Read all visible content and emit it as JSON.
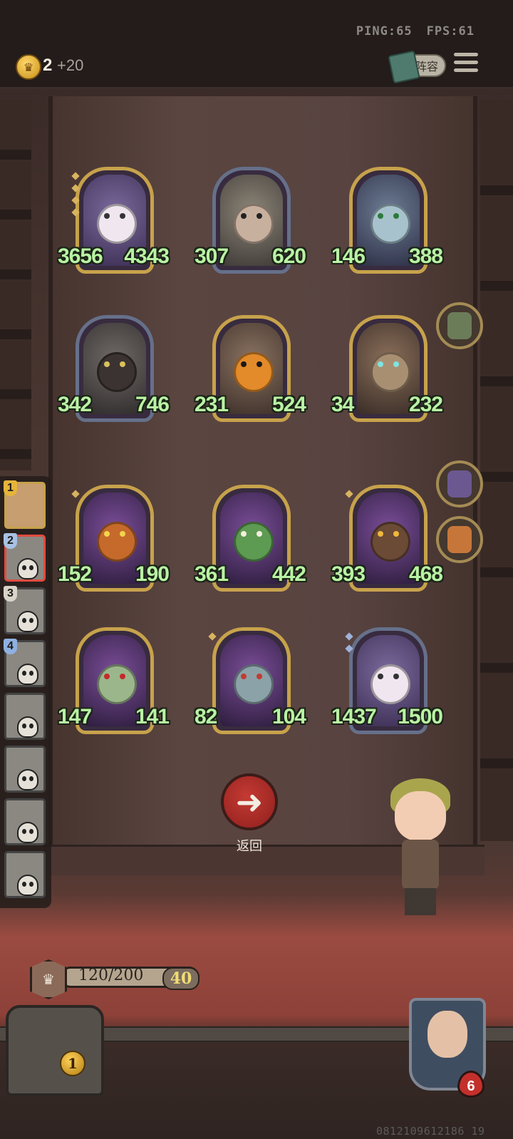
{
  "hud": {
    "ping": "PING:65",
    "fps": "FPS:61",
    "coins": "2",
    "coin_income": "+20",
    "lineup_label": "阵容"
  },
  "cards": [
    {
      "atk": "3656",
      "hp": "4343",
      "frame": "gold",
      "stars": 4,
      "star_color": "gold",
      "name_icon": "hero-witch-icon"
    },
    {
      "atk": "307",
      "hp": "620",
      "frame": "silver",
      "stars": 0,
      "name_icon": "hero-brute-icon"
    },
    {
      "atk": "146",
      "hp": "388",
      "frame": "gold",
      "stars": 0,
      "name_icon": "hero-elf-icon"
    },
    {
      "atk": "342",
      "hp": "746",
      "frame": "silver",
      "stars": 0,
      "name_icon": "hero-dragon-icon"
    },
    {
      "atk": "231",
      "hp": "524",
      "frame": "gold",
      "stars": 0,
      "name_icon": "hero-pumpkin-icon"
    },
    {
      "atk": "34",
      "hp": "232",
      "frame": "gold",
      "stars": 0,
      "name_icon": "hero-treant-icon"
    },
    {
      "atk": "152",
      "hp": "190",
      "frame": "gold",
      "stars": 1,
      "star_color": "gold",
      "name_icon": "hero-pumpkin-beast-icon"
    },
    {
      "atk": "361",
      "hp": "442",
      "frame": "gold",
      "stars": 0,
      "name_icon": "hero-cactus-icon"
    },
    {
      "atk": "393",
      "hp": "468",
      "frame": "gold",
      "stars": 1,
      "star_color": "gold",
      "name_icon": "hero-tiki-icon"
    },
    {
      "atk": "147",
      "hp": "141",
      "frame": "gold",
      "stars": 0,
      "name_icon": "hero-demon-icon"
    },
    {
      "atk": "82",
      "hp": "104",
      "frame": "gold",
      "stars": 1,
      "star_color": "gold",
      "name_icon": "hero-horned-beast-icon"
    },
    {
      "atk": "1437",
      "hp": "1500",
      "frame": "silver",
      "stars": 2,
      "star_color": "blue",
      "name_icon": "hero-witch-icon"
    }
  ],
  "side_buttons": [
    "bonsai-icon",
    "voodoo-doll-icon",
    "fire-card-icon"
  ],
  "roster": [
    {
      "num": "1",
      "state": "active"
    },
    {
      "num": "2",
      "state": "selected"
    },
    {
      "num": "3",
      "state": "defeated"
    },
    {
      "num": "4",
      "state": "defeated"
    },
    {
      "num": "",
      "state": "defeated"
    },
    {
      "num": "",
      "state": "defeated"
    },
    {
      "num": "",
      "state": "defeated"
    },
    {
      "num": "",
      "state": "defeated"
    }
  ],
  "back_button": {
    "label": "返回"
  },
  "level": {
    "xp": "120/200",
    "xp_fraction": 0.6,
    "gold": "40"
  },
  "chest": {
    "count": "1"
  },
  "player": {
    "lives": "6"
  },
  "serial": "0812109612186 19"
}
